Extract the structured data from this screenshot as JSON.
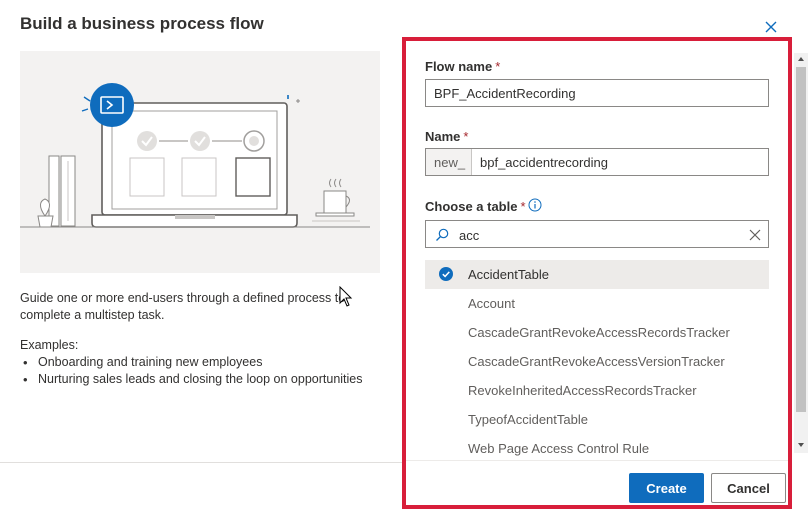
{
  "dialog": {
    "title": "Build a business process flow",
    "description": "Guide one or more end-users through a defined process to complete a multistep task.",
    "examples_label": "Examples:",
    "examples": [
      "Onboarding and training new employees",
      "Nurturing sales leads and closing the loop on opportunities"
    ]
  },
  "form": {
    "flow_name": {
      "label": "Flow name",
      "required": "*",
      "value": "BPF_AccidentRecording"
    },
    "name": {
      "label": "Name",
      "required": "*",
      "prefix": "new_",
      "value": "bpf_accidentrecording"
    },
    "table": {
      "label": "Choose a table",
      "required": "*",
      "search_value": "acc",
      "options": [
        "AccidentTable",
        "Account",
        "CascadeGrantRevokeAccessRecordsTracker",
        "CascadeGrantRevokeAccessVersionTracker",
        "RevokeInheritedAccessRecordsTracker",
        "TypeofAccidentTable",
        "Web Page Access Control Rule"
      ],
      "selected_index": 0
    }
  },
  "buttons": {
    "create": "Create",
    "cancel": "Cancel"
  },
  "colors": {
    "accent": "#0f6cbd",
    "highlight_border": "#d81e3a",
    "selected_row": "#edebe9"
  }
}
